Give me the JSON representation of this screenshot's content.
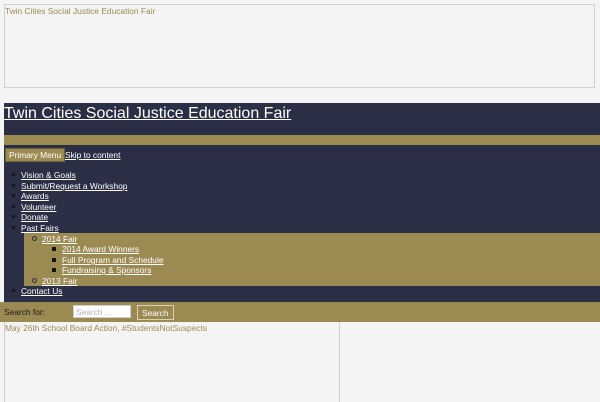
{
  "header_image": {
    "alt_text": "Twin Cities Social Justice Education Fair"
  },
  "site": {
    "title": "Twin Cities Social Justice Education Fair"
  },
  "navigation": {
    "menu_toggle_label": "Primary Menu",
    "skip_link_label": "Skip to content",
    "items": [
      {
        "label": "Vision & Goals"
      },
      {
        "label": "Submit/Request a Workshop"
      },
      {
        "label": "Awards"
      },
      {
        "label": "Volunteer"
      },
      {
        "label": "Donate"
      },
      {
        "label": "Past Fairs"
      }
    ],
    "past_fairs": {
      "fair_2014": {
        "label": "2014 Fair",
        "children": [
          {
            "label": "2014 Award Winners"
          },
          {
            "label": "Full Program and Schedule"
          },
          {
            "label": "Fundraising & Sponsors"
          }
        ]
      },
      "fair_2013": {
        "label": "2013 Fair"
      }
    },
    "contact": {
      "label": "Contact Us"
    }
  },
  "search": {
    "label": "Search for:",
    "placeholder": "Search …",
    "button_label": "Search"
  },
  "content": {
    "post_title": "May 26th School Board Action, #StudentsNotSuspects"
  },
  "colors": {
    "navy": "#2b2f45",
    "gold": "#9b8a52",
    "background": "#f4f4f4",
    "link": "#ffffff"
  }
}
